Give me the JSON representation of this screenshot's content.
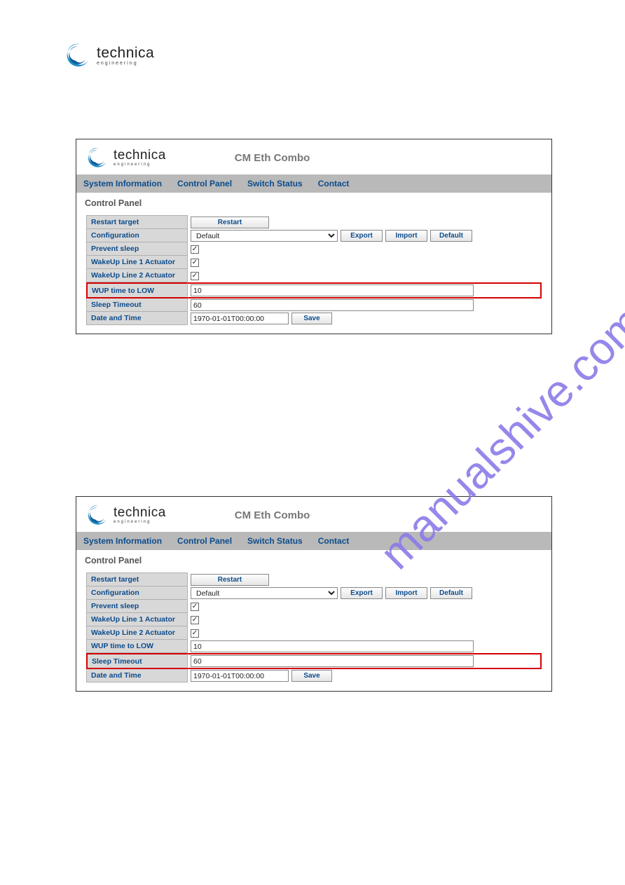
{
  "brand": {
    "name": "technica",
    "tagline": "engineering"
  },
  "watermark": "manualshive.com",
  "app_title": "CM Eth Combo",
  "nav": [
    {
      "label": "System Information"
    },
    {
      "label": "Control Panel"
    },
    {
      "label": "Switch Status"
    },
    {
      "label": "Contact"
    }
  ],
  "section_title": "Control Panel",
  "buttons": {
    "restart": "Restart",
    "export": "Export",
    "import": "Import",
    "default": "Default",
    "save": "Save"
  },
  "rows": {
    "restart_target": "Restart target",
    "configuration": "Configuration",
    "prevent_sleep": "Prevent sleep",
    "wakeup1": "WakeUp Line 1 Actuator",
    "wakeup2": "WakeUp Line 2 Actuator",
    "wup_low": "WUP time to LOW",
    "sleep_timeout": "Sleep Timeout",
    "date_time": "Date and Time"
  },
  "values": {
    "configuration": "Default",
    "prevent_sleep_checked": true,
    "wakeup1_checked": true,
    "wakeup2_checked": true,
    "wup_low": "10",
    "sleep_timeout": "60",
    "date_time": "1970-01-01T00:00:00"
  },
  "panels": [
    {
      "highlight": "wup_low"
    },
    {
      "highlight": "sleep_timeout"
    }
  ]
}
